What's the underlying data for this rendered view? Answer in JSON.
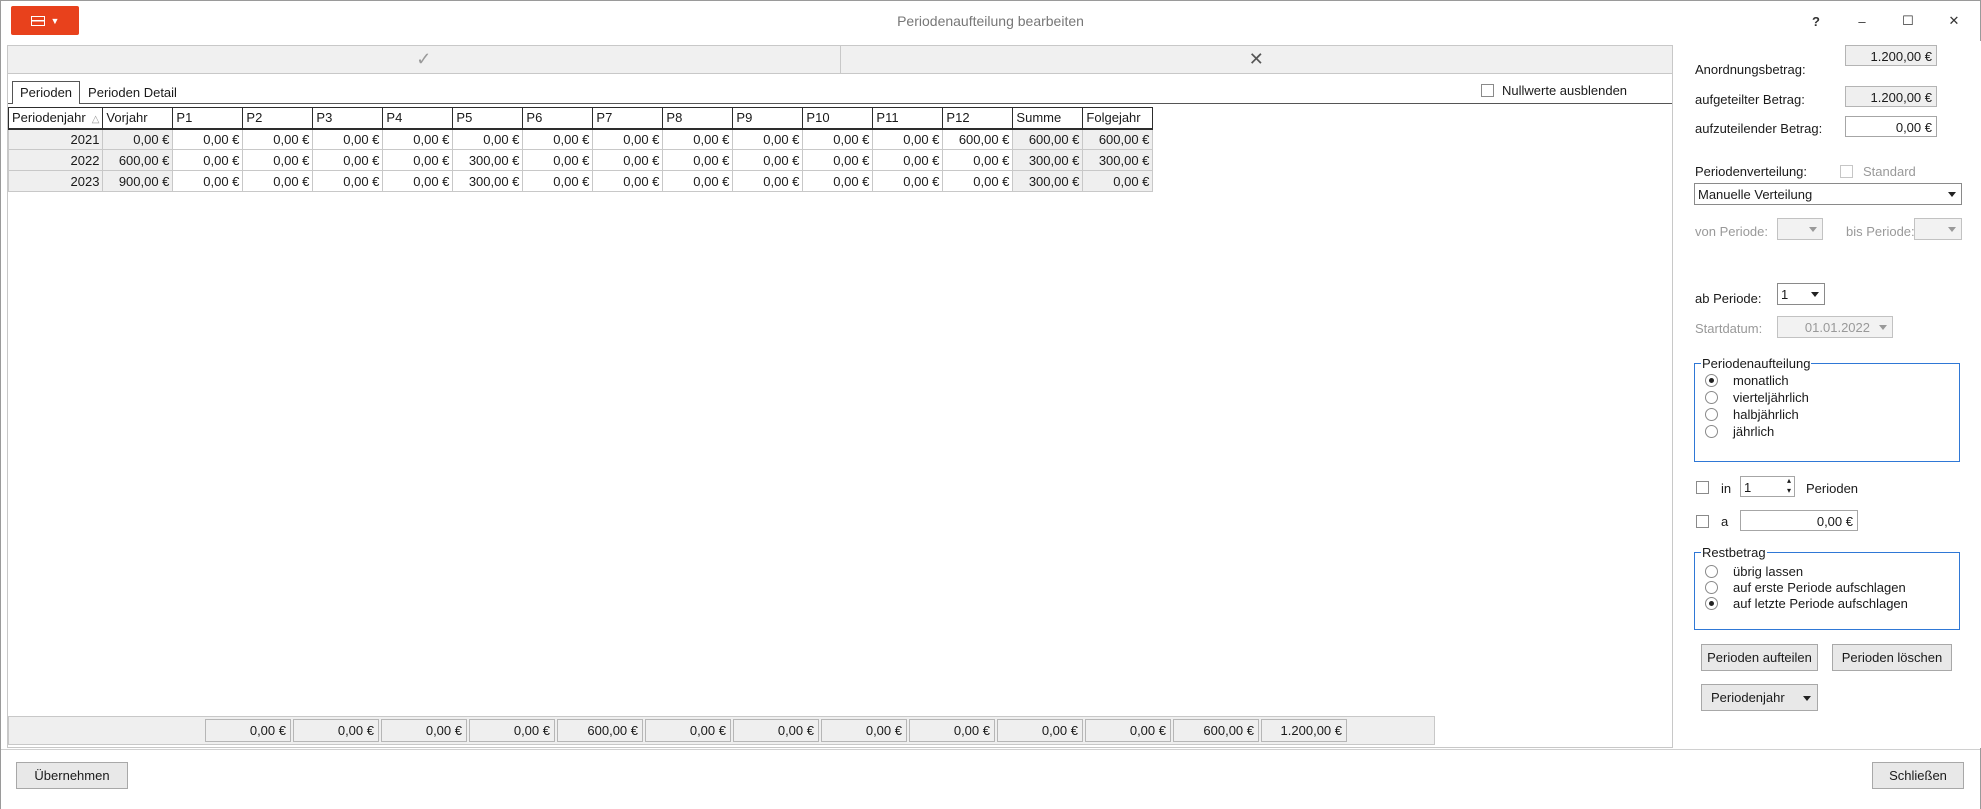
{
  "window": {
    "title": "Periodenaufteilung bearbeiten",
    "help": "?",
    "minimize": "–",
    "maximize": "☐",
    "close": "✕"
  },
  "toolbar": {
    "confirm_icon": "checkmark-icon",
    "cancel_icon": "close-icon",
    "confirm_glyph": "✓",
    "cancel_glyph": "✕"
  },
  "tabs": [
    {
      "label": "Perioden",
      "active": true
    },
    {
      "label": "Perioden Detail",
      "active": false
    }
  ],
  "nullwerte_label": "Nullwerte ausblenden",
  "grid": {
    "columns": [
      "Periodenjahr",
      "Vorjahr",
      "P1",
      "P2",
      "P3",
      "P4",
      "P5",
      "P6",
      "P7",
      "P8",
      "P9",
      "P10",
      "P11",
      "P12",
      "Summe",
      "Folgejahr"
    ],
    "sort_glyph": "△",
    "rows": [
      [
        "2021",
        "0,00 €",
        "0,00 €",
        "0,00 €",
        "0,00 €",
        "0,00 €",
        "0,00 €",
        "0,00 €",
        "0,00 €",
        "0,00 €",
        "0,00 €",
        "0,00 €",
        "0,00 €",
        "600,00 €",
        "600,00 €",
        "600,00 €"
      ],
      [
        "2022",
        "600,00 €",
        "0,00 €",
        "0,00 €",
        "0,00 €",
        "0,00 €",
        "300,00 €",
        "0,00 €",
        "0,00 €",
        "0,00 €",
        "0,00 €",
        "0,00 €",
        "0,00 €",
        "0,00 €",
        "300,00 €",
        "300,00 €"
      ],
      [
        "2023",
        "900,00 €",
        "0,00 €",
        "0,00 €",
        "0,00 €",
        "0,00 €",
        "300,00 €",
        "0,00 €",
        "0,00 €",
        "0,00 €",
        "0,00 €",
        "0,00 €",
        "0,00 €",
        "0,00 €",
        "300,00 €",
        "0,00 €"
      ]
    ],
    "totals": [
      "0,00 €",
      "0,00 €",
      "0,00 €",
      "0,00 €",
      "600,00 €",
      "0,00 €",
      "0,00 €",
      "0,00 €",
      "0,00 €",
      "0,00 €",
      "0,00 €",
      "600,00 €",
      "1.200,00 €"
    ]
  },
  "side": {
    "anordnungsbetrag_label": "Anordnungsbetrag:",
    "anordnungsbetrag": "1.200,00 €",
    "aufgeteilt_label": "aufgeteilter Betrag:",
    "aufgeteilt": "1.200,00 €",
    "aufzuteilen_label": "aufzuteilender Betrag:",
    "aufzuteilen": "0,00 €",
    "verteilung_label": "Periodenverteilung:",
    "standard_label": "Standard",
    "verteilung_value": "Manuelle Verteilung",
    "von_label": "von Periode:",
    "bis_label": "bis Periode:",
    "ab_label": "ab Periode:",
    "ab_value": "1",
    "startdatum_label": "Startdatum:",
    "startdatum_value": "01.01.2022",
    "aufteilung_group": "Periodenaufteilung",
    "aufteilung_options": [
      {
        "label": "monatlich",
        "selected": true
      },
      {
        "label": "vierteljährlich",
        "selected": false
      },
      {
        "label": "halbjährlich",
        "selected": false
      },
      {
        "label": "jährlich",
        "selected": false
      }
    ],
    "in_label": "in",
    "in_value": "1",
    "perioden_label": "Perioden",
    "a_label": "a",
    "a_value": "0,00 €",
    "rest_group": "Restbetrag",
    "rest_options": [
      {
        "label": "übrig lassen",
        "selected": false
      },
      {
        "label": "auf erste Periode aufschlagen",
        "selected": false
      },
      {
        "label": "auf letzte Periode aufschlagen",
        "selected": true
      }
    ],
    "btn_aufteilen": "Perioden aufteilen",
    "btn_loeschen": "Perioden löschen",
    "btn_periodenjahr": "Periodenjahr"
  },
  "bottom": {
    "uebernehmen": "Übernehmen",
    "schliessen": "Schließen"
  }
}
